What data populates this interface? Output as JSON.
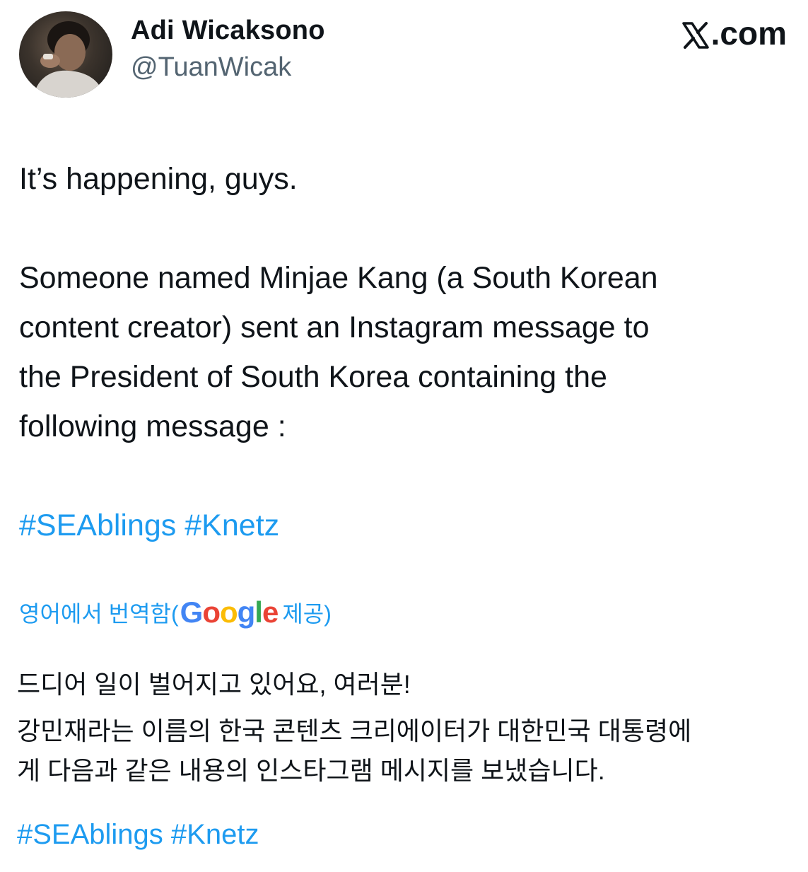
{
  "author": {
    "display_name": "Adi Wicaksono",
    "handle": "@TuanWicak",
    "avatar_icon": "user-photo-icon"
  },
  "brand": {
    "label": ".com",
    "icon": "x-logo-icon"
  },
  "tweet": {
    "line1": "It’s happening, guys.",
    "line2": "Someone named Minjae Kang (a South Korean",
    "line3": "content creator) sent an Instagram message to",
    "line4": "the President of South Korea containing the",
    "line5": "following message :",
    "hashtags": [
      "#SEAblings",
      "#Knetz"
    ]
  },
  "translation": {
    "prefix": "영어에서 번역함(",
    "provider": "Google",
    "suffix": " 제공)",
    "line1": "드디어 일이 벌어지고 있어요, 여러분!",
    "line2": "강민재라는 이름의 한국 콘텐츠 크리에이터가 대한민국 대통령에",
    "line3": "게 다음과 같은 내용의 인스타그램 메시지를 보냈습니다.",
    "hashtags": [
      "#SEAblings",
      "#Knetz"
    ]
  },
  "colors": {
    "link": "#1d9bf0",
    "secondary_text": "#536471",
    "primary_text": "#0f1419"
  }
}
